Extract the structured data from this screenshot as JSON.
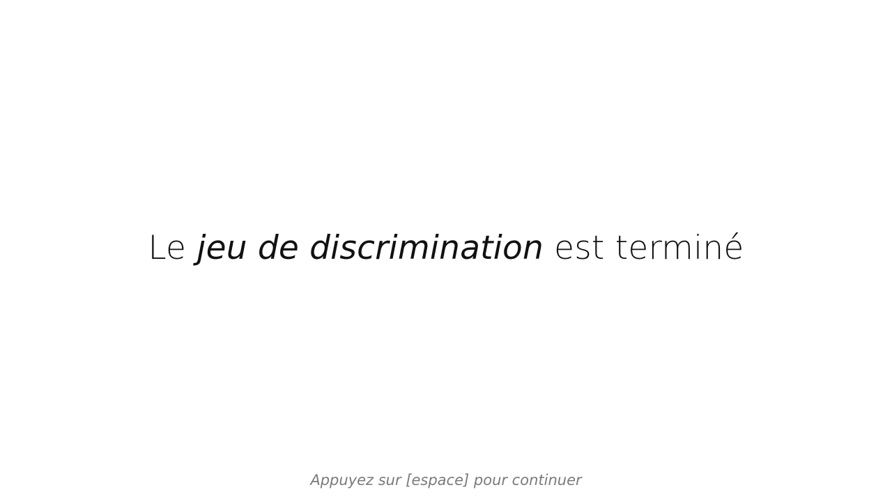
{
  "slide": {
    "title": {
      "prefix": "Le ",
      "emphasis": "jeu de discrimination",
      "suffix": " est terminé"
    },
    "hint": "Appuyez sur [espace] pour continuer"
  },
  "colors": {
    "background": "#ffffff",
    "title_text": "#111111",
    "hint_text": "#7a7a7a"
  }
}
